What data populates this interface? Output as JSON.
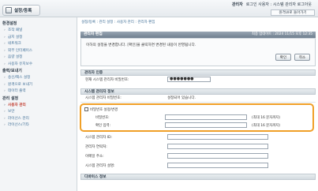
{
  "header": {
    "tab_label": "설정/등록",
    "admin_name": "관리자",
    "user_text": "로그인 사용자 : 시스템 관리자 로그아웃",
    "portal_link": "원격UI로 돌아가기"
  },
  "sidebar": {
    "sections": [
      {
        "title": "환경설정",
        "items": [
          "조작 패널",
          "급지 설정",
          "네트워크",
          "외부 인터페이스",
          "음량 설정",
          "사용자 유지보수"
        ]
      },
      {
        "title": "출력/보내기",
        "items": [
          "송신/팩스 설정",
          "원격으로 보내기",
          "데이터 출력"
        ]
      },
      {
        "title": "관리 설정",
        "items": [
          "사용자 관리",
          "보안",
          "라이선스 관리",
          "라이선스/기타"
        ]
      }
    ],
    "active_item": "사용자 관리"
  },
  "breadcrumb": "설정/등록 : 관리 설정 : 사용자 관리 : 관리자 편집",
  "page": {
    "title": "관리자 편집",
    "timestamp": "최종 업데이트 : 2024 11/15 오후 12:35",
    "notice": "이하의 설정을 변경합니다. [확인]을 클릭하면 변경된 내용이 반영됩니다.",
    "ok_button": "확인",
    "cancel_button": "취소"
  },
  "auth_section": {
    "title": "관리자 인증",
    "label": "현재 시스템 관리자 비밀번호:",
    "value": "●●●●●●●"
  },
  "info_section": {
    "title": "시스템 관리자 정보",
    "status_label": "시스템 관리자 비밀번호:",
    "status_value": "설정되어 있습니다.",
    "change_checkbox_label": "비밀번호 설정/변경",
    "password_label": "비밀번호:",
    "confirm_label": "확인 입력:",
    "max_hint": "(최대 16 문자까지)",
    "fields": [
      {
        "label": "시스템 관리자 ID:",
        "value": ""
      },
      {
        "label": "관리자 연락처:",
        "value": ""
      },
      {
        "label": "이메일 주소:",
        "value": ""
      },
      {
        "label": "시스템 관리자 설명:",
        "value": ""
      }
    ]
  },
  "device_section": {
    "title": "디바이스 정보"
  },
  "accent_color": "#f0a028"
}
